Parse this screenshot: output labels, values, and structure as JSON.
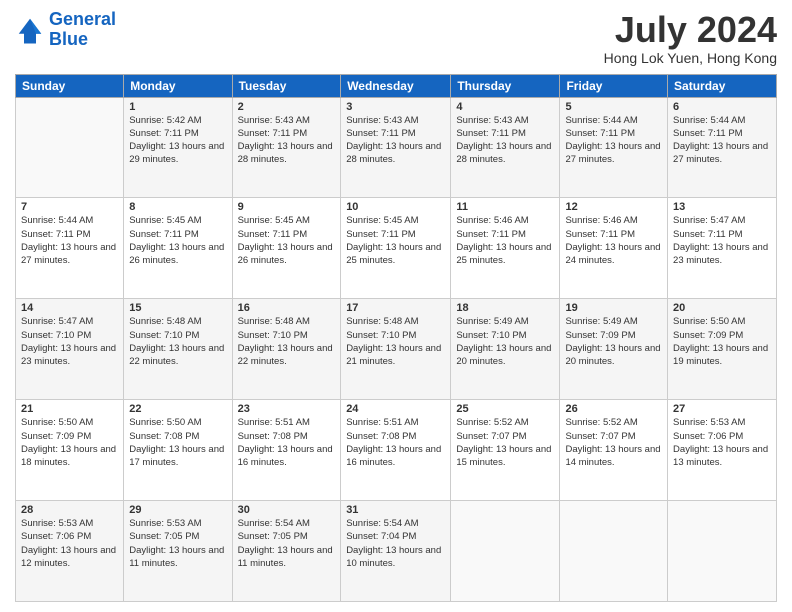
{
  "header": {
    "logo_line1": "General",
    "logo_line2": "Blue",
    "month": "July 2024",
    "location": "Hong Lok Yuen, Hong Kong"
  },
  "days_of_week": [
    "Sunday",
    "Monday",
    "Tuesday",
    "Wednesday",
    "Thursday",
    "Friday",
    "Saturday"
  ],
  "weeks": [
    [
      {
        "day": "",
        "sunrise": "",
        "sunset": "",
        "daylight": ""
      },
      {
        "day": "1",
        "sunrise": "Sunrise: 5:42 AM",
        "sunset": "Sunset: 7:11 PM",
        "daylight": "Daylight: 13 hours and 29 minutes."
      },
      {
        "day": "2",
        "sunrise": "Sunrise: 5:43 AM",
        "sunset": "Sunset: 7:11 PM",
        "daylight": "Daylight: 13 hours and 28 minutes."
      },
      {
        "day": "3",
        "sunrise": "Sunrise: 5:43 AM",
        "sunset": "Sunset: 7:11 PM",
        "daylight": "Daylight: 13 hours and 28 minutes."
      },
      {
        "day": "4",
        "sunrise": "Sunrise: 5:43 AM",
        "sunset": "Sunset: 7:11 PM",
        "daylight": "Daylight: 13 hours and 28 minutes."
      },
      {
        "day": "5",
        "sunrise": "Sunrise: 5:44 AM",
        "sunset": "Sunset: 7:11 PM",
        "daylight": "Daylight: 13 hours and 27 minutes."
      },
      {
        "day": "6",
        "sunrise": "Sunrise: 5:44 AM",
        "sunset": "Sunset: 7:11 PM",
        "daylight": "Daylight: 13 hours and 27 minutes."
      }
    ],
    [
      {
        "day": "7",
        "sunrise": "Sunrise: 5:44 AM",
        "sunset": "Sunset: 7:11 PM",
        "daylight": "Daylight: 13 hours and 27 minutes."
      },
      {
        "day": "8",
        "sunrise": "Sunrise: 5:45 AM",
        "sunset": "Sunset: 7:11 PM",
        "daylight": "Daylight: 13 hours and 26 minutes."
      },
      {
        "day": "9",
        "sunrise": "Sunrise: 5:45 AM",
        "sunset": "Sunset: 7:11 PM",
        "daylight": "Daylight: 13 hours and 26 minutes."
      },
      {
        "day": "10",
        "sunrise": "Sunrise: 5:45 AM",
        "sunset": "Sunset: 7:11 PM",
        "daylight": "Daylight: 13 hours and 25 minutes."
      },
      {
        "day": "11",
        "sunrise": "Sunrise: 5:46 AM",
        "sunset": "Sunset: 7:11 PM",
        "daylight": "Daylight: 13 hours and 25 minutes."
      },
      {
        "day": "12",
        "sunrise": "Sunrise: 5:46 AM",
        "sunset": "Sunset: 7:11 PM",
        "daylight": "Daylight: 13 hours and 24 minutes."
      },
      {
        "day": "13",
        "sunrise": "Sunrise: 5:47 AM",
        "sunset": "Sunset: 7:11 PM",
        "daylight": "Daylight: 13 hours and 23 minutes."
      }
    ],
    [
      {
        "day": "14",
        "sunrise": "Sunrise: 5:47 AM",
        "sunset": "Sunset: 7:10 PM",
        "daylight": "Daylight: 13 hours and 23 minutes."
      },
      {
        "day": "15",
        "sunrise": "Sunrise: 5:48 AM",
        "sunset": "Sunset: 7:10 PM",
        "daylight": "Daylight: 13 hours and 22 minutes."
      },
      {
        "day": "16",
        "sunrise": "Sunrise: 5:48 AM",
        "sunset": "Sunset: 7:10 PM",
        "daylight": "Daylight: 13 hours and 22 minutes."
      },
      {
        "day": "17",
        "sunrise": "Sunrise: 5:48 AM",
        "sunset": "Sunset: 7:10 PM",
        "daylight": "Daylight: 13 hours and 21 minutes."
      },
      {
        "day": "18",
        "sunrise": "Sunrise: 5:49 AM",
        "sunset": "Sunset: 7:10 PM",
        "daylight": "Daylight: 13 hours and 20 minutes."
      },
      {
        "day": "19",
        "sunrise": "Sunrise: 5:49 AM",
        "sunset": "Sunset: 7:09 PM",
        "daylight": "Daylight: 13 hours and 20 minutes."
      },
      {
        "day": "20",
        "sunrise": "Sunrise: 5:50 AM",
        "sunset": "Sunset: 7:09 PM",
        "daylight": "Daylight: 13 hours and 19 minutes."
      }
    ],
    [
      {
        "day": "21",
        "sunrise": "Sunrise: 5:50 AM",
        "sunset": "Sunset: 7:09 PM",
        "daylight": "Daylight: 13 hours and 18 minutes."
      },
      {
        "day": "22",
        "sunrise": "Sunrise: 5:50 AM",
        "sunset": "Sunset: 7:08 PM",
        "daylight": "Daylight: 13 hours and 17 minutes."
      },
      {
        "day": "23",
        "sunrise": "Sunrise: 5:51 AM",
        "sunset": "Sunset: 7:08 PM",
        "daylight": "Daylight: 13 hours and 16 minutes."
      },
      {
        "day": "24",
        "sunrise": "Sunrise: 5:51 AM",
        "sunset": "Sunset: 7:08 PM",
        "daylight": "Daylight: 13 hours and 16 minutes."
      },
      {
        "day": "25",
        "sunrise": "Sunrise: 5:52 AM",
        "sunset": "Sunset: 7:07 PM",
        "daylight": "Daylight: 13 hours and 15 minutes."
      },
      {
        "day": "26",
        "sunrise": "Sunrise: 5:52 AM",
        "sunset": "Sunset: 7:07 PM",
        "daylight": "Daylight: 13 hours and 14 minutes."
      },
      {
        "day": "27",
        "sunrise": "Sunrise: 5:53 AM",
        "sunset": "Sunset: 7:06 PM",
        "daylight": "Daylight: 13 hours and 13 minutes."
      }
    ],
    [
      {
        "day": "28",
        "sunrise": "Sunrise: 5:53 AM",
        "sunset": "Sunset: 7:06 PM",
        "daylight": "Daylight: 13 hours and 12 minutes."
      },
      {
        "day": "29",
        "sunrise": "Sunrise: 5:53 AM",
        "sunset": "Sunset: 7:05 PM",
        "daylight": "Daylight: 13 hours and 11 minutes."
      },
      {
        "day": "30",
        "sunrise": "Sunrise: 5:54 AM",
        "sunset": "Sunset: 7:05 PM",
        "daylight": "Daylight: 13 hours and 11 minutes."
      },
      {
        "day": "31",
        "sunrise": "Sunrise: 5:54 AM",
        "sunset": "Sunset: 7:04 PM",
        "daylight": "Daylight: 13 hours and 10 minutes."
      },
      {
        "day": "",
        "sunrise": "",
        "sunset": "",
        "daylight": ""
      },
      {
        "day": "",
        "sunrise": "",
        "sunset": "",
        "daylight": ""
      },
      {
        "day": "",
        "sunrise": "",
        "sunset": "",
        "daylight": ""
      }
    ]
  ]
}
